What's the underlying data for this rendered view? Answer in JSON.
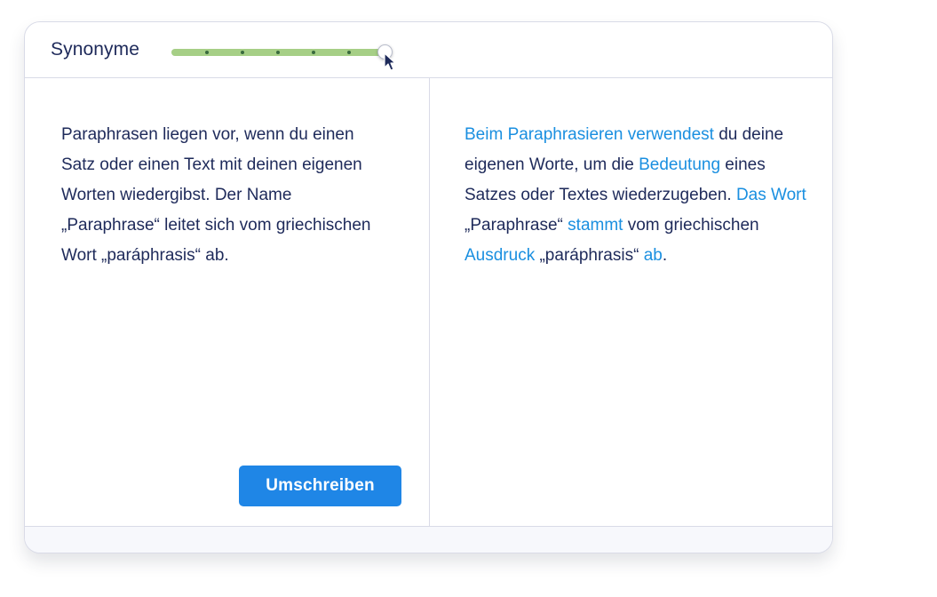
{
  "header": {
    "mode_label": "Synonyme",
    "slider": {
      "steps": 6,
      "value_fraction": 1.0,
      "fill_color": "#a6cf86",
      "track_color": "#e4e7ef"
    }
  },
  "input_pane": {
    "text": "Paraphrasen liegen vor, wenn du einen Satz oder einen Text mit deinen eigenen Worten wiedergibst. Der Name „Paraphrase“ leitet sich vom griechischen Wort „paráphrasis“ ab."
  },
  "rewrite_button": {
    "label": "Umschreiben",
    "color": "#1f86e6"
  },
  "output_pane": {
    "changed_color": "#1a8fe0",
    "segments": [
      {
        "text": "Beim Paraphrasieren verwendest",
        "changed": true
      },
      {
        "text": " du deine eigenen Worte, um die ",
        "changed": false
      },
      {
        "text": "Bedeutung",
        "changed": true
      },
      {
        "text": " eines Satzes oder Textes wiederzugeben. ",
        "changed": false
      },
      {
        "text": "Das Wort",
        "changed": true
      },
      {
        "text": " „Paraphrase“ ",
        "changed": false
      },
      {
        "text": "stammt",
        "changed": true
      },
      {
        "text": " vom griechischen ",
        "changed": false
      },
      {
        "text": "Ausdruck",
        "changed": true
      },
      {
        "text": " „paráphrasis“ ",
        "changed": false
      },
      {
        "text": "ab",
        "changed": true
      },
      {
        "text": ".",
        "changed": false
      }
    ]
  },
  "icons": {
    "cursor": "mouse-pointer-icon"
  }
}
